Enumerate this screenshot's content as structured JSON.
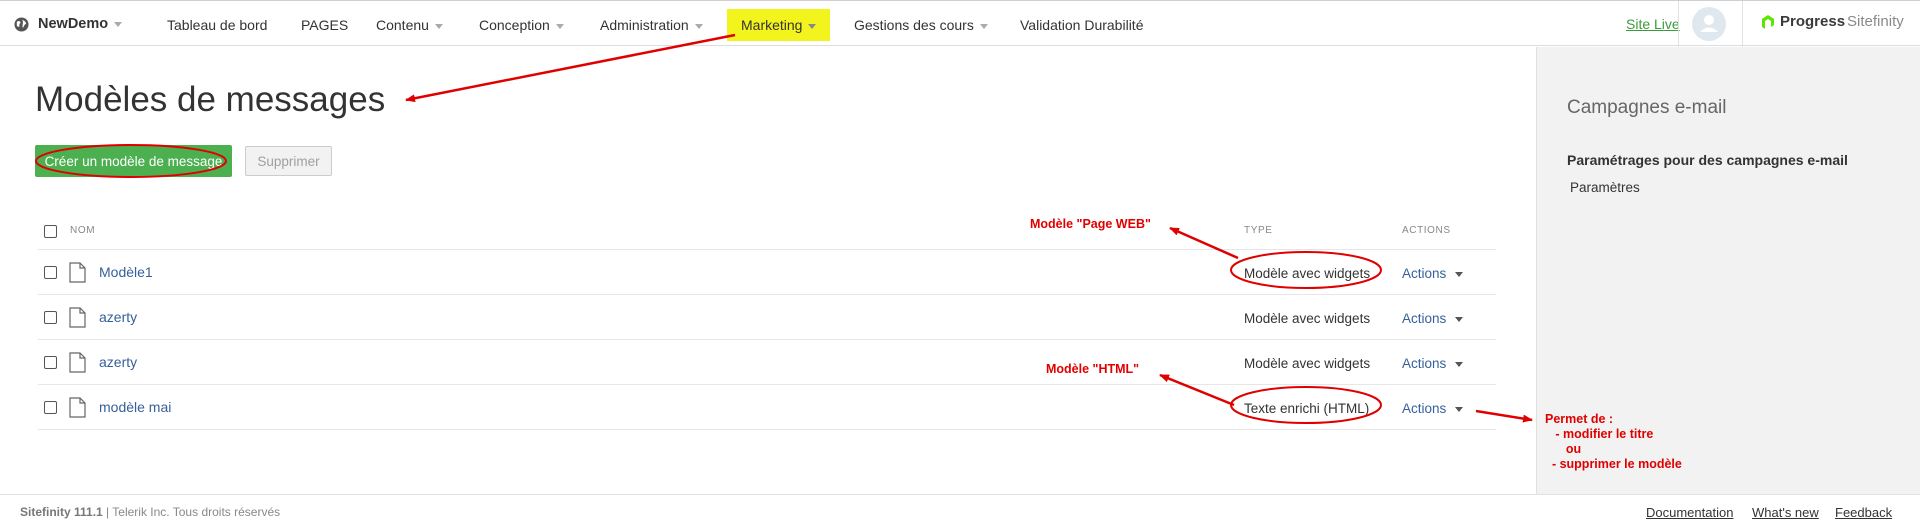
{
  "topnav": {
    "brand": "NewDemo",
    "items": [
      {
        "label": "Tableau de bord",
        "caret": false
      },
      {
        "label": "PAGES",
        "caret": false
      },
      {
        "label": "Contenu",
        "caret": true
      },
      {
        "label": "Conception",
        "caret": true
      },
      {
        "label": "Administration",
        "caret": true
      },
      {
        "label": "Marketing",
        "caret": true,
        "highlighted": true
      },
      {
        "label": "Gestions des cours",
        "caret": true
      },
      {
        "label": "Validation Durabilité",
        "caret": false
      }
    ],
    "site_live": "Site Live",
    "logo_progress": "Progress",
    "logo_sitefinity": "Sitefinity"
  },
  "main": {
    "title": "Modèles de messages",
    "create_button": "Créer un modèle de message",
    "delete_button": "Supprimer",
    "table": {
      "headers": {
        "name": "NOM",
        "type": "TYPE",
        "actions": "ACTIONS"
      },
      "rows": [
        {
          "name": "Modèle1",
          "type": "Modèle avec widgets",
          "actions": "Actions"
        },
        {
          "name": "azerty",
          "type": "Modèle avec widgets",
          "actions": "Actions"
        },
        {
          "name": "azerty",
          "type": "Modèle avec widgets",
          "actions": "Actions"
        },
        {
          "name": "modèle mai",
          "type": "Texte enrichi (HTML)",
          "actions": "Actions"
        }
      ]
    }
  },
  "sidebar": {
    "title": "Campagnes e-mail",
    "subtitle": "Paramétrages pour des campagnes e-mail",
    "link": "Paramètres"
  },
  "footer": {
    "version": "Sitefinity 111.1",
    "copyright": " | Telerik Inc. Tous droits réservés",
    "links": [
      "Documentation",
      "What's new",
      "Feedback"
    ]
  },
  "annotations": {
    "page_web": "Modèle \"Page WEB\"",
    "html": "Modèle \"HTML\"",
    "permet": "Permet de :\n   - modifier le titre\n      ou\n  - supprimer le modèle",
    "color": "#e00000"
  },
  "colors": {
    "accent_green": "#4caf50",
    "link_blue": "#36609a",
    "highlight_yellow": "#f3f31e"
  }
}
